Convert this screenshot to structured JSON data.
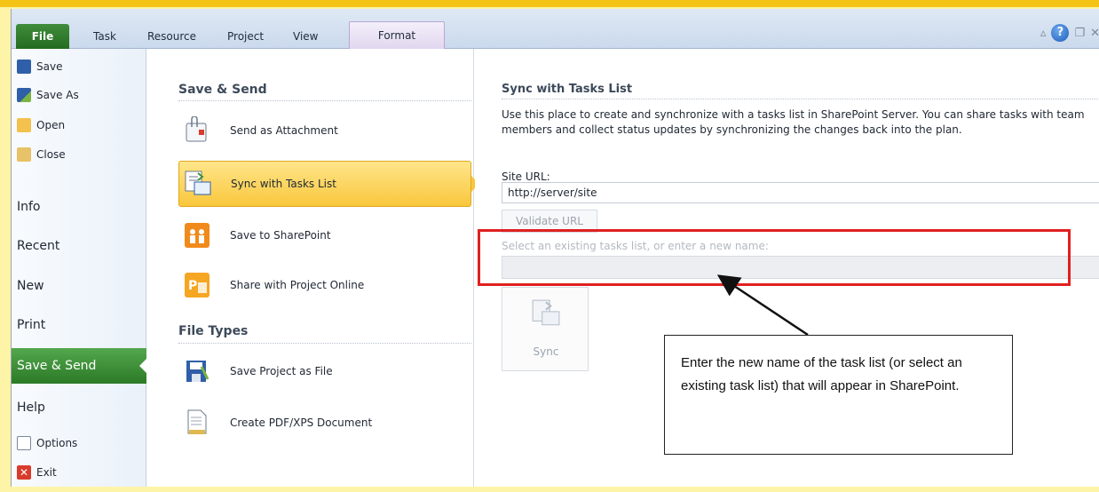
{
  "ribbon": {
    "tabs": [
      "File",
      "Task",
      "Resource",
      "Project",
      "View",
      "Format"
    ],
    "icons": [
      "minimize-ribbon-icon",
      "help-icon",
      "restore-icon",
      "close-icon"
    ]
  },
  "nav": {
    "save": "Save",
    "save_as": "Save As",
    "open": "Open",
    "close": "Close",
    "info": "Info",
    "recent": "Recent",
    "new": "New",
    "print": "Print",
    "save_send": "Save & Send",
    "help": "Help",
    "options": "Options",
    "exit": "Exit"
  },
  "middle": {
    "save_send_heading": "Save & Send",
    "file_types_heading": "File Types",
    "items": [
      {
        "label": "Send as Attachment",
        "icon": "attachment-icon"
      },
      {
        "label": "Sync with Tasks List",
        "icon": "tasks-list-icon"
      },
      {
        "label": "Save to SharePoint",
        "icon": "sharepoint-icon"
      },
      {
        "label": "Share with Project Online",
        "icon": "project-online-icon"
      }
    ],
    "file_types": [
      {
        "label": "Save Project as File",
        "icon": "save-project-icon"
      },
      {
        "label": "Create PDF/XPS Document",
        "icon": "pdf-document-icon"
      }
    ]
  },
  "right": {
    "title": "Sync with Tasks List",
    "description": "Use this place to create and synchronize with a tasks list in SharePoint Server. You can share tasks with team members and collect status updates by synchronizing the changes back into the plan.",
    "site_url_label": "Site URL:",
    "site_url_value": "http://server/site",
    "validate_label": "Validate URL",
    "list_label": "Select an existing tasks list, or enter a new name:",
    "list_value": "",
    "sync_label": "Sync"
  },
  "annotation": {
    "callout_text": "Enter the new name of the task list (or select an existing task list) that will appear in SharePoint.",
    "highlight_color": "#e02020"
  },
  "colors": {
    "file_tab": "#2c7a27",
    "active_item": "#f9c73d",
    "frame_accent": "#f3c316"
  }
}
